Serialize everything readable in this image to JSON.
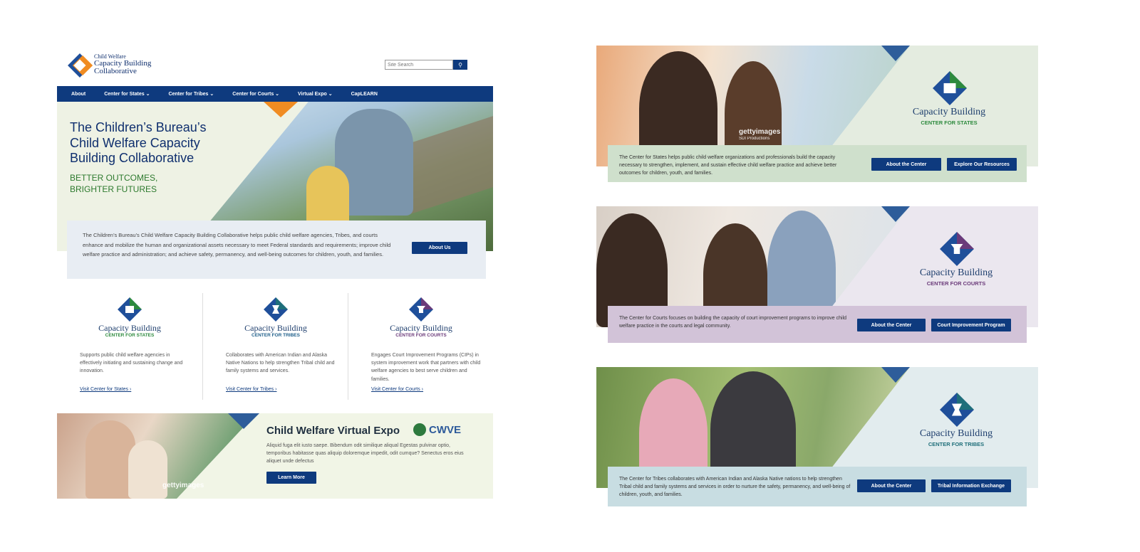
{
  "site": {
    "logo": {
      "line1": "Child Welfare",
      "line2": "Capacity Building",
      "line3": "Collaborative"
    },
    "search_placeholder": "Site Search",
    "nav": [
      "About",
      "Center for States ⌄",
      "Center for Tribes ⌄",
      "Center for Courts ⌄",
      "Virtual Expo ⌄",
      "CapLEARN"
    ],
    "hero": {
      "title": "The Children’s Bureau’s Child Welfare Capacity Building Collaborative",
      "subtitle_line1": "BETTER OUTCOMES,",
      "subtitle_line2": "BRIGHTER FUTURES",
      "body": "The Children’s Bureau’s Child Welfare Capacity Building Collaborative helps public child welfare agencies, Tribes, and courts enhance and mobilize the human and organizational assets necessary to meet Federal standards and requirements; improve child welfare practice and administration; and achieve safety, permanency, and well-being outcomes for children, youth, and families.",
      "button": "About Us"
    },
    "centers": [
      {
        "title": "Capacity Building",
        "sub": "CENTER FOR STATES",
        "color": "#2d8a3e",
        "desc": "Supports public child welfare agencies in effectively initiating and sustaining change and innovation.",
        "link": "Visit Center for States ›"
      },
      {
        "title": "Capacity Building",
        "sub": "CENTER FOR TRIBES",
        "color": "#1f5f8a",
        "desc": "Collaborates with American Indian and Alaska Native Nations to help strengthen Tribal child and family systems and services.",
        "link": "Visit Center for Tribes ›"
      },
      {
        "title": "Capacity Building",
        "sub": "CENTER FOR COURTS",
        "color": "#6b3a7a",
        "desc": "Engages Court Improvement Programs (CIPs) in system improvement work that partners with child welfare agencies to best serve children and families.",
        "link": "Visit Center for Courts ›"
      }
    ],
    "expo": {
      "title": "Child Welfare Virtual Expo",
      "logo": "CWVE",
      "body": "Aliquid fuga elit iusto saepe. Bibendum odit similique aliqual Egestas pulvinar optio, temporibus habitasse quas aliquip doloremque impedit, odit cumque? Senectus eros eius aliquet unde defectus",
      "button": "Learn More",
      "getty": "gettyimages"
    }
  },
  "banners": [
    {
      "title": "Capacity Building",
      "sub": "CENTER FOR STATES",
      "sub_color": "#2d8a3e",
      "bg": "#e4ece0",
      "bar": "#cfe0cc",
      "getty": "gettyimages",
      "getty_sub": "SDI Productions",
      "text": "The Center for States helps public child welfare organizations and professionals build the capacity necessary to strengthen, implement, and sustain effective child welfare practice and achieve better outcomes for children, youth, and families.",
      "btn1": "About the Center",
      "btn2": "Explore Our Resources"
    },
    {
      "title": "Capacity Building",
      "sub": "CENTER FOR COURTS",
      "sub_color": "#6b3a7a",
      "bg": "#ebe7ef",
      "bar": "#d2c3d8",
      "text": "The Center for Courts focuses on building the capacity of court improvement programs to improve child welfare practice in the courts and legal community.",
      "btn1": "About the Center",
      "btn2": "Court Improvement Program"
    },
    {
      "title": "Capacity Building",
      "sub": "CENTER FOR TRIBES",
      "sub_color": "#1f6f7a",
      "bg": "#e2ecee",
      "bar": "#c8dde2",
      "text": "The Center for Tribes collaborates with American Indian and Alaska Native nations to help strengthen Tribal child and family systems and services in order to nurture the safety, permanency, and well-being of children, youth, and families.",
      "btn1": "About the Center",
      "btn2": "Tribal Information Exchange"
    }
  ],
  "colors": {
    "navy": "#0e3a7e",
    "orange": "#f08c22",
    "green": "#2d8a3e",
    "purple": "#6b3a7a",
    "teal": "#1f6f7a"
  }
}
